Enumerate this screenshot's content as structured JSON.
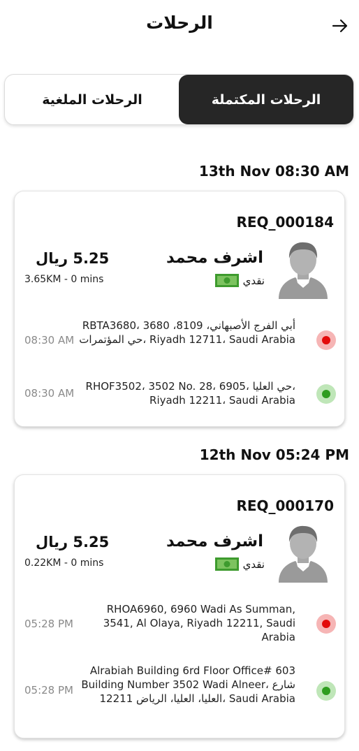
{
  "header": {
    "title": "الرحلات",
    "back_icon": "arrow-right-icon"
  },
  "tabs": {
    "completed": "الرحلات المكتملة",
    "cancelled": "الرحلات الملغية",
    "active": "completed"
  },
  "colors": {
    "active_tab_bg": "#262626",
    "pickup_dot": "#e30b0b",
    "dropoff_dot": "#2e9d1f",
    "time_text": "#8a8a8a"
  },
  "trips": [
    {
      "date": "13th Nov 08:30 AM",
      "request_id": "REQ_000184",
      "driver_name": "اشرف محمد",
      "payment_method": "نقدي",
      "fare": "5.25 ريال",
      "distance": "3.65KM - 0 mins",
      "pickup": {
        "address": "RBTA3680، 3680 أبي الفرج الأصبهاني، 8109، حي المؤتمرات، Riyadh 12711، Saudi Arabia",
        "time": "08:30 AM"
      },
      "dropoff": {
        "address": "RHOF3502، 3502 No. 28، 6905، حي العليا، Riyadh 12211، Saudi Arabia",
        "time": "08:30 AM"
      }
    },
    {
      "date": "12th Nov 05:24 PM",
      "request_id": "REQ_000170",
      "driver_name": "اشرف محمد",
      "payment_method": "نقدي",
      "fare": "5.25 ريال",
      "distance": "0.22KM - 0 mins",
      "pickup": {
        "address": "RHOA6960, 6960 Wadi As Summan, 3541, Al Olaya, Riyadh 12211, Saudi Arabia",
        "time": "05:28 PM"
      },
      "dropoff": {
        "address": "Alrabiah Building 6rd Floor Office# 603 Building Number 3502 Wadi Alneer، شارع العليا، العليا، الرياض 12211، Saudi Arabia",
        "time": "05:28 PM"
      }
    }
  ]
}
